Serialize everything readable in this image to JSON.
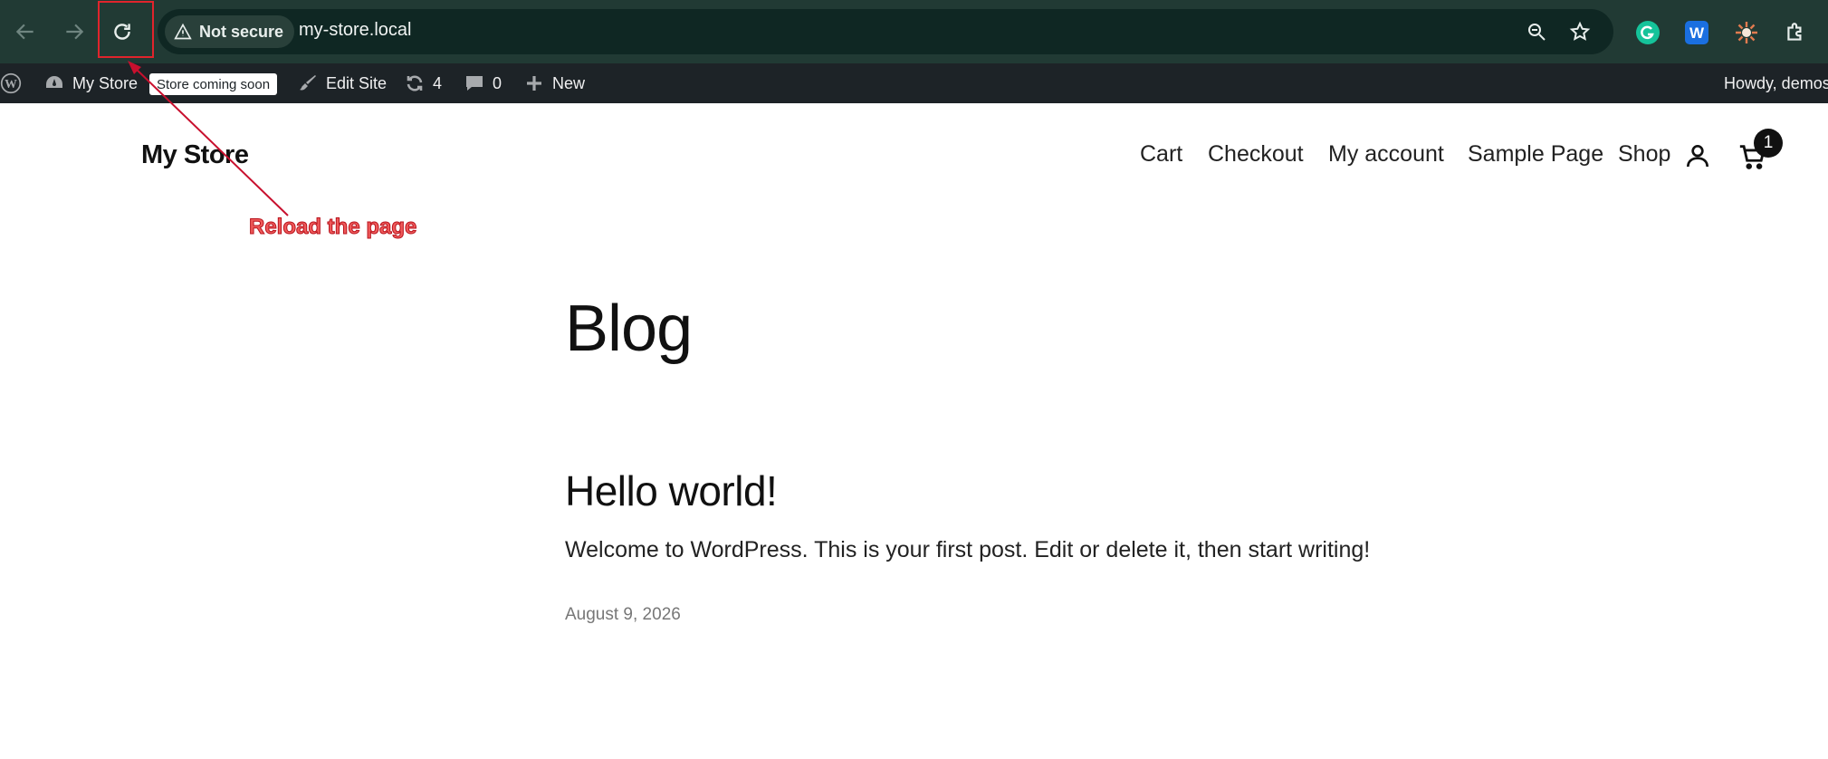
{
  "browser": {
    "security_label": "Not secure",
    "url": "my-store.local",
    "icons": [
      "back-arrow-icon",
      "forward-arrow-icon",
      "reload-icon",
      "warning-icon",
      "zoom-icon",
      "star-icon",
      "grammarly-icon",
      "w-extension-icon",
      "sun-extension-icon",
      "extensions-puzzle-icon"
    ]
  },
  "admin_bar": {
    "site_name": "My Store",
    "badge": "Store coming soon",
    "edit_site": "Edit Site",
    "updates_count": "4",
    "comments_count": "0",
    "new_label": "New",
    "howdy": "Howdy, demos"
  },
  "site": {
    "title": "My Store",
    "nav": [
      "Cart",
      "Checkout",
      "My account",
      "Sample Page",
      "Shop"
    ],
    "cart_count": "1"
  },
  "annotation": {
    "label": "Reload the page",
    "color": "#e0242c"
  },
  "content": {
    "heading": "Blog",
    "post": {
      "title": "Hello world!",
      "excerpt": "Welcome to WordPress. This is your first post. Edit or delete it, then start writing!",
      "date": "August 9, 2026"
    }
  }
}
